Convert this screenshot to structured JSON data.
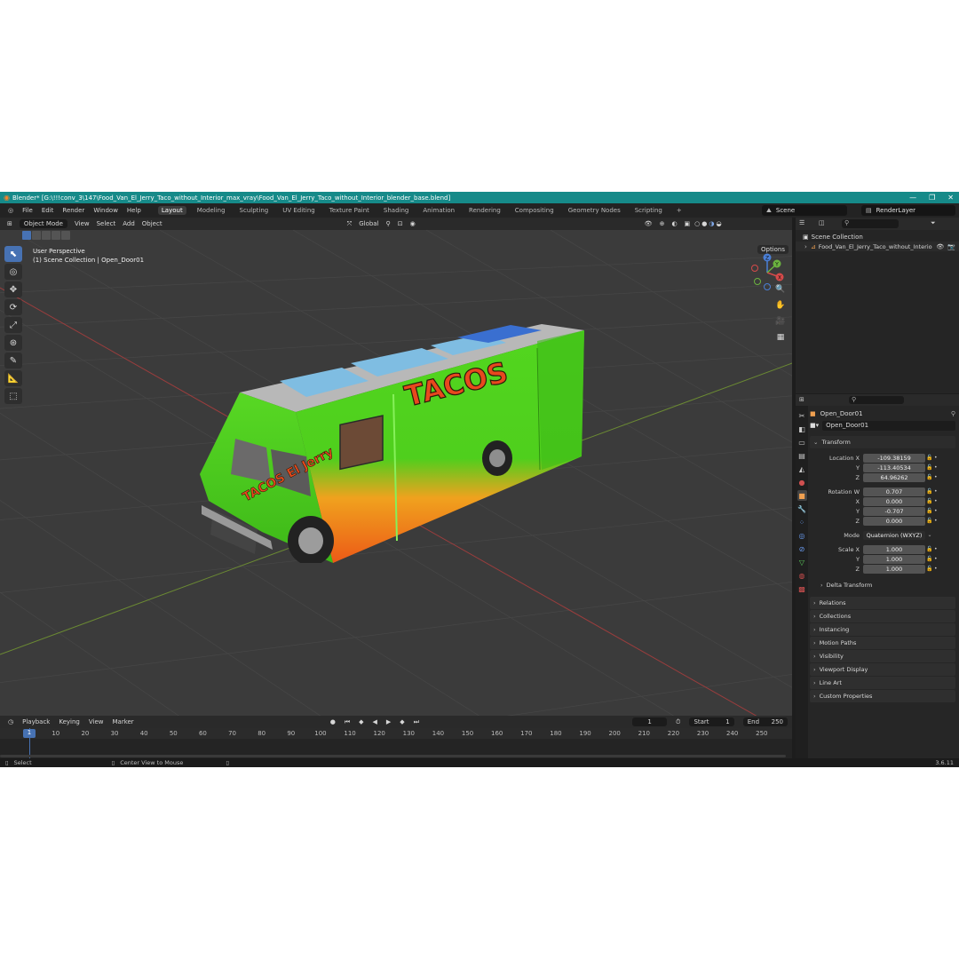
{
  "window": {
    "title": "Blender* [G:\\!!!conv_3\\147\\Food_Van_El_Jerry_Taco_without_Interior_max_vray\\Food_Van_El_Jerry_Taco_without_Interior_blender_base.blend]",
    "controls": [
      "—",
      "❐",
      "✕"
    ]
  },
  "menu": [
    "File",
    "Edit",
    "Render",
    "Window",
    "Help"
  ],
  "workspaces": [
    "Layout",
    "Modeling",
    "Sculpting",
    "UV Editing",
    "Texture Paint",
    "Shading",
    "Animation",
    "Rendering",
    "Compositing",
    "Geometry Nodes",
    "Scripting",
    "+"
  ],
  "scene": {
    "scene_name": "Scene",
    "render_layer": "RenderLayer"
  },
  "viewport": {
    "mode": "Object Mode",
    "menus": [
      "View",
      "Select",
      "Add",
      "Object"
    ],
    "orientation": "Global",
    "options_label": "Options",
    "info_line1": "User Perspective",
    "info_line2": "(1) Scene Collection | Open_Door01",
    "gizmo_labels": {
      "z": "Z",
      "x": "X",
      "y": "Y"
    }
  },
  "outliner": {
    "root": "Scene Collection",
    "item": "Food_Van_El_Jerry_Taco_without_Interio"
  },
  "properties": {
    "object_name": "Open_Door01",
    "data_name": "Open_Door01",
    "transform_label": "Transform",
    "location_label": "Location X",
    "location": [
      "-109.38159",
      "-113.40534",
      "64.96262"
    ],
    "rotation_label": "Rotation W",
    "rotation": [
      "0.707",
      "0.000",
      "-0.707",
      "0.000"
    ],
    "mode_label": "Mode",
    "mode_value": "Quaternion (WXYZ)",
    "scale_label": "Scale X",
    "scale": [
      "1.000",
      "1.000",
      "1.000"
    ],
    "axis_labels": {
      "y": "Y",
      "z": "Z",
      "x": "X"
    },
    "delta_transform": "Delta Transform",
    "sections": [
      "Relations",
      "Collections",
      "Instancing",
      "Motion Paths",
      "Visibility",
      "Viewport Display",
      "Line Art",
      "Custom Properties"
    ]
  },
  "timeline": {
    "menus": [
      "Playback",
      "Keying",
      "View",
      "Marker"
    ],
    "current_frame": "1",
    "start_label": "Start",
    "start": "1",
    "end_label": "End",
    "end": "250",
    "playhead_label": "1",
    "ticks": [
      "10",
      "20",
      "30",
      "40",
      "50",
      "60",
      "70",
      "80",
      "90",
      "100",
      "110",
      "120",
      "130",
      "140",
      "150",
      "160",
      "170",
      "180",
      "190",
      "200",
      "210",
      "220",
      "230",
      "240",
      "250"
    ]
  },
  "statusbar": {
    "select": "Select",
    "center_view": "Center View to Mouse",
    "version": "3.6.11"
  },
  "truck_text": {
    "main": "TACOS",
    "side": "TACOS El Jerry"
  },
  "colors": {
    "titlebar": "#168a89",
    "accent": "#4772b3",
    "truck_green": "#4bd11e",
    "truck_orange": "#f07a1e"
  }
}
